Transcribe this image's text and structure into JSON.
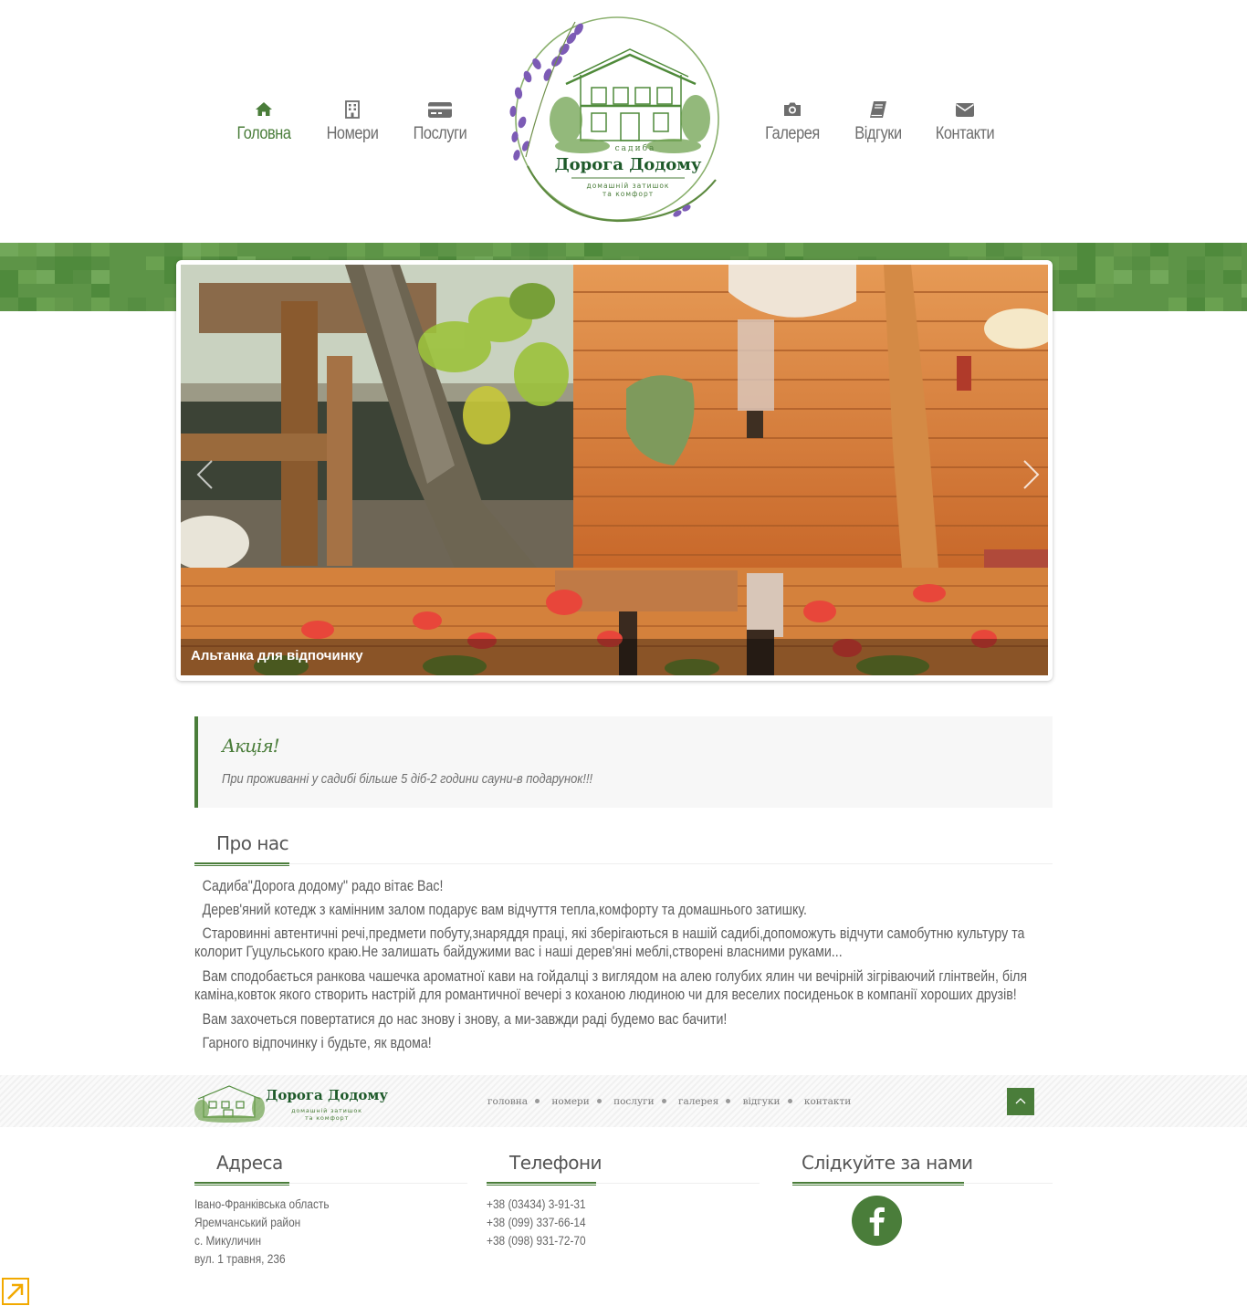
{
  "nav": {
    "left": [
      {
        "label": "Головна",
        "icon": "home-icon",
        "active": true
      },
      {
        "label": "Номери",
        "icon": "building-icon",
        "active": false
      },
      {
        "label": "Послуги",
        "icon": "credit-card-icon",
        "active": false
      }
    ],
    "right": [
      {
        "label": "Галерея",
        "icon": "camera-icon",
        "active": false
      },
      {
        "label": "Відгуки",
        "icon": "book-icon",
        "active": false
      },
      {
        "label": "Контакти",
        "icon": "envelope-icon",
        "active": false
      }
    ]
  },
  "logo": {
    "small": "садиба",
    "name": "Дорога Додому",
    "tagline_1": "домашній затишок",
    "tagline_2": "та комфорт"
  },
  "slider": {
    "caption": "Альтанка для відпочинку"
  },
  "promo": {
    "title": "Акція!",
    "text": "При проживанні у садибі більше 5 діб-2 години сауни-в подарунок!!!"
  },
  "about": {
    "heading": "Про нас",
    "paragraphs": [
      "Садиба\"Дорога додому\" радо вітає Вас!",
      "Дерев'яний котедж з камінним залом подарує вам відчуття тепла,комфорту та домашнього затишку.",
      "Старовинні автентичні речі,предмети побуту,знаряддя праці, які зберігаються в нашій садибі,допоможуть відчути самобутню культуру та колорит  Гуцульського краю.Не залишать байдужими вас і наші дерев'яні меблі,створені власними руками...",
      "Вам сподобається ранкова чашечка ароматної кави на гойдалці з виглядом на алею голубих ялин чи вечірній зігріваючий глінтвейн, біля каміна,ковток якого створить настрій для романтичної вечері з коханою людиною чи для веселих посиденьок в компанії хороших друзів!",
      "Вам захочеться повертатися до нас знову і знову, а ми-завжди раді будемо вас бачити!",
      "Гарного відпочинку і будьте, як вдома!"
    ]
  },
  "footer": {
    "logo_name": "Дорога Додому",
    "logo_tagline_1": "домашній затишок",
    "logo_tagline_2": "та комфорт",
    "links": [
      "головна",
      "номери",
      "послуги",
      "галерея",
      "відгуки",
      "контакти"
    ],
    "address": {
      "heading": "Адреса",
      "lines": [
        "Івано-Франківська область",
        "Яремчанський район",
        "с. Микуличин",
        "вул. 1 травня, 236"
      ]
    },
    "phones": {
      "heading": "Телефони",
      "lines": [
        "+38 (03434) 3-91-31",
        "+38 (099) 337-66-14",
        "+38 (098) 931-72-70"
      ]
    },
    "social": {
      "heading": "Слідкуйте за нами",
      "facebook_icon": "facebook-icon"
    }
  },
  "colors": {
    "accent": "#4a7d3a",
    "band": "#5d9447"
  }
}
